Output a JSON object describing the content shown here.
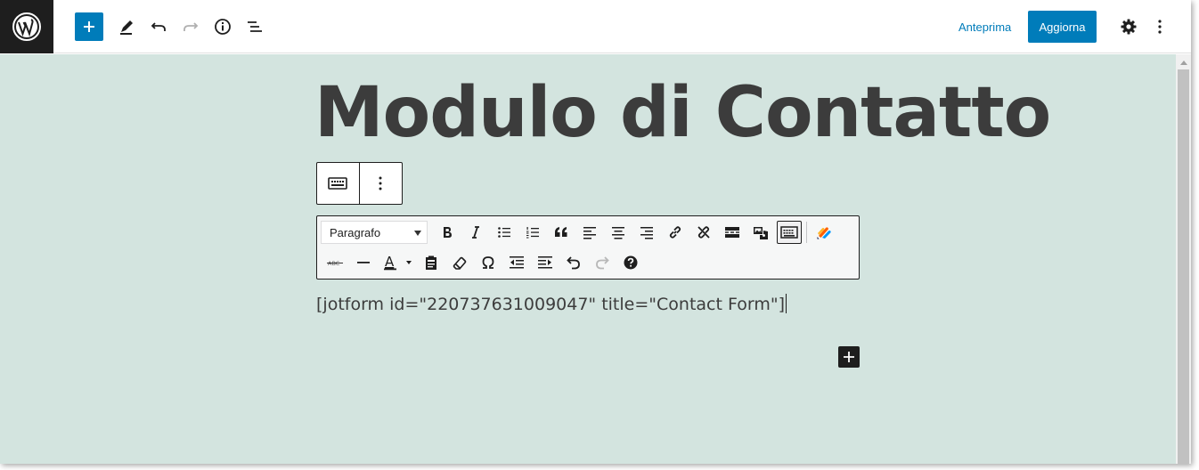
{
  "header": {
    "preview_label": "Anteprima",
    "update_label": "Aggiorna"
  },
  "post": {
    "title": "Modulo di Contatto",
    "shortcode": "[jotform id=\"220737631009047\" title=\"Contact Form\"]"
  },
  "classic_toolbar": {
    "format_value": "Paragrafo"
  },
  "colors": {
    "accent": "#007cba",
    "canvas_bg": "#d3e4df",
    "dark": "#1e1e1e"
  }
}
